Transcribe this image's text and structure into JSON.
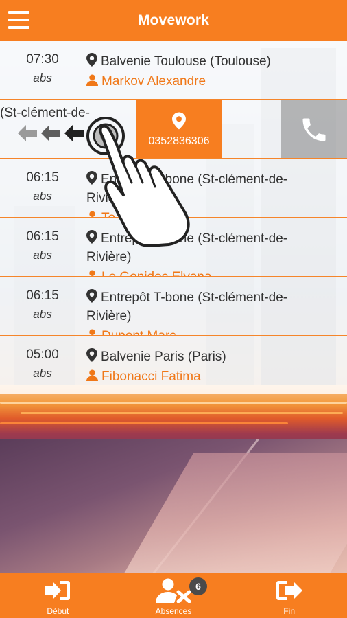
{
  "app": {
    "title": "Movework"
  },
  "colors": {
    "accent": "#f77e20",
    "text": "#333333"
  },
  "rows": [
    {
      "time": "07:30",
      "status": "abs",
      "place": "Balvenie Toulouse (Toulouse)",
      "person": "Markov Alexandre"
    },
    {
      "swiped_text": "(St-clément-de-",
      "phone": "0352836306"
    },
    {
      "time": "06:15",
      "status": "abs",
      "place": "Entrepôt T-bone (St-clément-de-Rivière)",
      "person": "To"
    },
    {
      "time": "06:15",
      "status": "abs",
      "place": "Entrepôt T-bone (St-clément-de-Rivière)",
      "person": "Le Gonidec Elyana"
    },
    {
      "time": "06:15",
      "status": "abs",
      "place": "Entrepôt T-bone (St-clément-de-Rivière)",
      "person": "Dupont Marc"
    },
    {
      "time": "05:00",
      "status": "abs",
      "place": "Balvenie Paris (Paris)",
      "person": "Fibonacci Fatima"
    }
  ],
  "footer": {
    "tabs": [
      {
        "label": "Début",
        "icon": "sign-in-icon"
      },
      {
        "label": "Absences",
        "icon": "user-absent-icon",
        "badge": "6"
      },
      {
        "label": "Fin",
        "icon": "sign-out-icon"
      }
    ]
  },
  "icons": {
    "menu": "hamburger-icon",
    "pin": "map-pin-icon",
    "person": "user-icon",
    "call": "phone-icon",
    "gesture": "swipe-hand-icon"
  }
}
